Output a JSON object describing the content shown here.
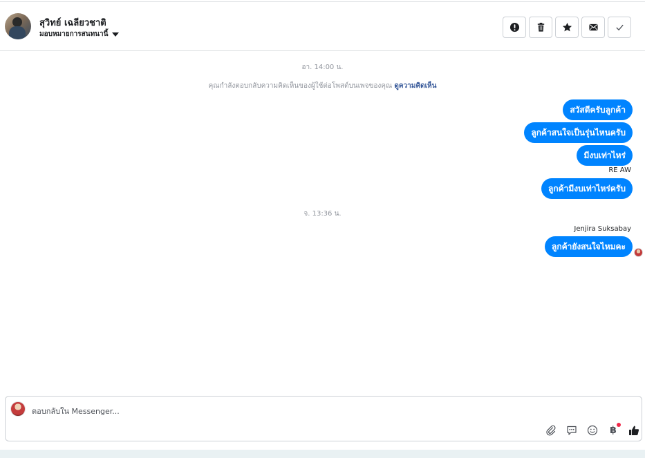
{
  "header": {
    "contact_name": "สุวิทย์ เฉลียวชาติ",
    "assign_label": "มอบหมายการสนทนานี้",
    "actions": [
      {
        "name": "spam-button",
        "icon": "exclamation-icon"
      },
      {
        "name": "delete-button",
        "icon": "trash-icon"
      },
      {
        "name": "star-button",
        "icon": "star-icon"
      },
      {
        "name": "mark-unread-button",
        "icon": "envelope-icon"
      },
      {
        "name": "mark-done-button",
        "icon": "check-icon"
      }
    ]
  },
  "conversation": {
    "timestamp_1": "อา. 14:00 น.",
    "system_note": "คุณกำลังตอบกลับความคิดเห็นของผู้ใช้ต่อโพสต์บนเพจของคุณ",
    "system_note_link": "ดูความคิดเห็น",
    "messages_1": [
      "สวัสดีครับลูกค้า",
      "ลูกค้าสนใจเป็นรุ่นไหนครับ",
      "มีงบเท่าไหร่"
    ],
    "sender_1": "RE AW",
    "messages_2": [
      "ลูกค้ามีงบเท่าไหร่ครับ"
    ],
    "timestamp_2": "จ. 13:36 น.",
    "sender_2": "Jenjira Suksabay",
    "messages_3": [
      "ลูกค้ายังสนใจไหมคะ"
    ]
  },
  "composer": {
    "placeholder": "ตอบกลับใน Messenger...",
    "value": "",
    "tools": [
      "paperclip-icon",
      "saved-reply-icon",
      "emoji-icon",
      "baht-icon",
      "thumbs-up-icon"
    ],
    "baht_symbol": "฿"
  },
  "colors": {
    "bubble": "#0084ff",
    "link": "#365899",
    "muted": "#90949c"
  }
}
